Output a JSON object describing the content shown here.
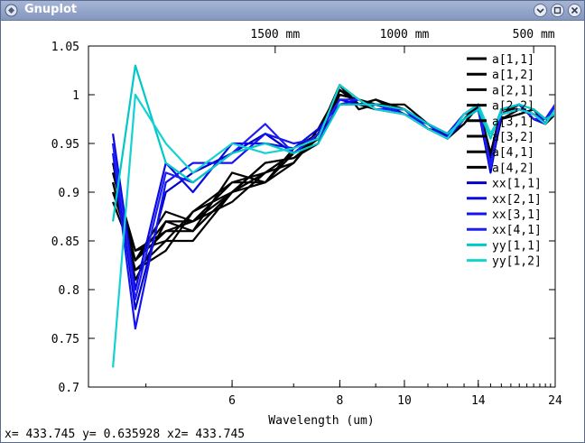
{
  "window": {
    "title": "Gnuplot",
    "buttons": [
      "chevron-down-icon",
      "restore-icon",
      "close-icon"
    ]
  },
  "status": {
    "text": "x= 433.745 y= 0.635928 x2= 433.745"
  },
  "chart_data": {
    "type": "line",
    "xlabel": "Wavelength (um)",
    "x_scale": "reciprocal",
    "xlim": [
      4.5,
      24
    ],
    "ylim": [
      0.7,
      1.05
    ],
    "x_ticks": [
      6,
      8,
      10,
      14,
      24
    ],
    "y_ticks": [
      0.7,
      0.75,
      0.8,
      0.85,
      0.9,
      0.95,
      1,
      1.05
    ],
    "y_tick_labels": [
      "0.7",
      "0.75",
      "0.8",
      "0.85",
      "0.9",
      "0.95",
      "1",
      "1.05"
    ],
    "x2_ticks": [
      {
        "x": 6.667,
        "label": "1500 mm"
      },
      {
        "x": 10,
        "label": "1000 mm"
      },
      {
        "x": 20,
        "label": "500 mm"
      }
    ],
    "grid": false,
    "legend_position": "top-right",
    "series": [
      {
        "name": "a[1,1]",
        "color": "#000000",
        "x": [
          4.7,
          4.9,
          5.2,
          5.5,
          6,
          6.5,
          7,
          7.5,
          8,
          8.5,
          9,
          10,
          11,
          12,
          13,
          14,
          15,
          16,
          18,
          20,
          22,
          24
        ],
        "y": [
          0.91,
          0.82,
          0.84,
          0.88,
          0.9,
          0.91,
          0.93,
          0.96,
          1.01,
          0.995,
          0.99,
          0.985,
          0.97,
          0.955,
          0.975,
          0.99,
          0.93,
          0.98,
          0.985,
          0.98,
          0.97,
          0.99
        ]
      },
      {
        "name": "a[1,2]",
        "color": "#000000",
        "x": [
          4.7,
          4.9,
          5.2,
          5.5,
          6,
          6.5,
          7,
          7.5,
          8,
          8.5,
          9,
          10,
          11,
          12,
          13,
          14,
          15,
          16,
          18,
          20,
          22,
          24
        ],
        "y": [
          0.92,
          0.83,
          0.86,
          0.87,
          0.91,
          0.92,
          0.94,
          0.955,
          1.005,
          0.99,
          0.995,
          0.98,
          0.965,
          0.96,
          0.98,
          0.985,
          0.925,
          0.975,
          0.98,
          0.985,
          0.975,
          0.985
        ]
      },
      {
        "name": "a[2,1]",
        "color": "#000000",
        "x": [
          4.7,
          4.9,
          5.2,
          5.5,
          6,
          6.5,
          7,
          7.5,
          8,
          8.5,
          9,
          10,
          11,
          12,
          13,
          14,
          15,
          16,
          18,
          20,
          22,
          24
        ],
        "y": [
          0.9,
          0.84,
          0.85,
          0.85,
          0.9,
          0.93,
          0.935,
          0.95,
          1.01,
          0.985,
          0.99,
          0.99,
          0.97,
          0.958,
          0.975,
          0.99,
          0.935,
          0.98,
          0.99,
          0.975,
          0.97,
          0.98
        ]
      },
      {
        "name": "a[2,2]",
        "color": "#000000",
        "x": [
          4.7,
          4.9,
          5.2,
          5.5,
          6,
          6.5,
          7,
          7.5,
          8,
          8.5,
          9,
          10,
          11,
          12,
          13,
          14,
          15,
          16,
          18,
          20,
          22,
          24
        ],
        "y": [
          0.93,
          0.81,
          0.87,
          0.86,
          0.92,
          0.91,
          0.94,
          0.96,
          1.0,
          0.995,
          0.99,
          0.985,
          0.965,
          0.955,
          0.97,
          0.988,
          0.94,
          0.985,
          0.985,
          0.98,
          0.975,
          0.99
        ]
      },
      {
        "name": "a[3,1]",
        "color": "#000000",
        "x": [
          4.7,
          4.9,
          5.2,
          5.5,
          6,
          6.5,
          7,
          7.5,
          8,
          8.5,
          9,
          10,
          11,
          12,
          13,
          14,
          15,
          16,
          18,
          20,
          22,
          24
        ],
        "y": [
          0.89,
          0.83,
          0.88,
          0.87,
          0.89,
          0.92,
          0.93,
          0.965,
          1.005,
          0.99,
          0.985,
          0.98,
          0.97,
          0.958,
          0.975,
          0.985,
          0.93,
          0.975,
          0.98,
          0.985,
          0.97,
          0.985
        ]
      },
      {
        "name": "a[3,2]",
        "color": "#000000",
        "x": [
          4.7,
          4.9,
          5.2,
          5.5,
          6,
          6.5,
          7,
          7.5,
          8,
          8.5,
          9,
          10,
          11,
          12,
          13,
          14,
          15,
          16,
          18,
          20,
          22,
          24
        ],
        "y": [
          0.91,
          0.82,
          0.85,
          0.88,
          0.91,
          0.91,
          0.945,
          0.96,
          1.01,
          0.99,
          0.995,
          0.985,
          0.965,
          0.96,
          0.98,
          0.99,
          0.935,
          0.98,
          0.985,
          0.98,
          0.975,
          0.99
        ]
      },
      {
        "name": "a[4,1]",
        "color": "#000000",
        "x": [
          4.7,
          4.9,
          5.2,
          5.5,
          6,
          6.5,
          7,
          7.5,
          8,
          8.5,
          9,
          10,
          11,
          12,
          13,
          14,
          15,
          16,
          18,
          20,
          22,
          24
        ],
        "y": [
          0.92,
          0.84,
          0.86,
          0.86,
          0.9,
          0.93,
          0.935,
          0.955,
          1.0,
          0.995,
          0.99,
          0.98,
          0.97,
          0.955,
          0.975,
          0.985,
          0.93,
          0.98,
          0.99,
          0.975,
          0.97,
          0.98
        ]
      },
      {
        "name": "a[4,2]",
        "color": "#000000",
        "x": [
          4.7,
          4.9,
          5.2,
          5.5,
          6,
          6.5,
          7,
          7.5,
          8,
          8.5,
          9,
          10,
          11,
          12,
          13,
          14,
          15,
          16,
          18,
          20,
          22,
          24
        ],
        "y": [
          0.9,
          0.83,
          0.87,
          0.87,
          0.9,
          0.92,
          0.94,
          0.96,
          1.005,
          0.99,
          0.99,
          0.985,
          0.965,
          0.958,
          0.97,
          0.99,
          0.94,
          0.975,
          0.985,
          0.98,
          0.975,
          0.985
        ]
      },
      {
        "name": "xx[1,1]",
        "color": "#0000c8",
        "x": [
          4.7,
          4.9,
          5.2,
          5.5,
          6,
          6.5,
          7,
          7.5,
          8,
          8.5,
          9,
          10,
          11,
          12,
          13,
          14,
          15,
          16,
          18,
          20,
          22,
          24
        ],
        "y": [
          0.95,
          0.78,
          0.9,
          0.92,
          0.94,
          0.96,
          0.94,
          0.96,
          0.995,
          0.99,
          0.99,
          0.98,
          0.97,
          0.96,
          0.975,
          0.985,
          0.92,
          0.98,
          0.985,
          0.98,
          0.975,
          0.985
        ]
      },
      {
        "name": "xx[2,1]",
        "color": "#0a0ae0",
        "x": [
          4.7,
          4.9,
          5.2,
          5.5,
          6,
          6.5,
          7,
          7.5,
          8,
          8.5,
          9,
          10,
          11,
          12,
          13,
          14,
          15,
          16,
          18,
          20,
          22,
          24
        ],
        "y": [
          0.96,
          0.8,
          0.93,
          0.9,
          0.95,
          0.95,
          0.945,
          0.965,
          0.99,
          0.995,
          0.985,
          0.985,
          0.965,
          0.958,
          0.98,
          0.99,
          0.925,
          0.985,
          0.99,
          0.975,
          0.97,
          0.99
        ]
      },
      {
        "name": "xx[3,1]",
        "color": "#1414f0",
        "x": [
          4.7,
          4.9,
          5.2,
          5.5,
          6,
          6.5,
          7,
          7.5,
          8,
          8.5,
          9,
          10,
          11,
          12,
          13,
          14,
          15,
          16,
          18,
          20,
          22,
          24
        ],
        "y": [
          0.94,
          0.76,
          0.91,
          0.93,
          0.93,
          0.96,
          0.95,
          0.955,
          0.99,
          0.99,
          0.99,
          0.98,
          0.97,
          0.955,
          0.975,
          0.985,
          0.93,
          0.98,
          0.985,
          0.98,
          0.975,
          0.985
        ]
      },
      {
        "name": "xx[4,1]",
        "color": "#1e1ef5",
        "x": [
          4.7,
          4.9,
          5.2,
          5.5,
          6,
          6.5,
          7,
          7.5,
          8,
          8.5,
          9,
          10,
          11,
          12,
          13,
          14,
          15,
          16,
          18,
          20,
          22,
          24
        ],
        "y": [
          0.95,
          0.79,
          0.92,
          0.91,
          0.94,
          0.97,
          0.94,
          0.96,
          0.995,
          0.995,
          0.985,
          0.985,
          0.97,
          0.96,
          0.98,
          0.99,
          0.925,
          0.985,
          0.99,
          0.975,
          0.975,
          0.99
        ]
      },
      {
        "name": "yy[1,1]",
        "color": "#00c8c8",
        "x": [
          4.7,
          4.9,
          5.2,
          5.5,
          6,
          6.5,
          7,
          7.5,
          8,
          8.5,
          9,
          10,
          11,
          12,
          13,
          14,
          15,
          16,
          18,
          20,
          22,
          24
        ],
        "y": [
          0.87,
          1.03,
          0.93,
          0.91,
          0.94,
          0.95,
          0.94,
          0.95,
          0.99,
          0.99,
          0.99,
          0.985,
          0.97,
          0.96,
          0.975,
          0.985,
          0.955,
          0.985,
          0.99,
          0.985,
          0.975,
          0.98
        ]
      },
      {
        "name": "yy[1,2]",
        "color": "#14d2d2",
        "x": [
          4.7,
          4.9,
          5.2,
          5.5,
          6,
          6.5,
          7,
          7.5,
          8,
          8.5,
          9,
          10,
          11,
          12,
          13,
          14,
          15,
          16,
          18,
          20,
          22,
          24
        ],
        "y": [
          0.72,
          1.0,
          0.95,
          0.92,
          0.95,
          0.94,
          0.945,
          0.955,
          1.01,
          0.995,
          0.985,
          0.98,
          0.965,
          0.955,
          0.98,
          0.99,
          0.96,
          0.98,
          0.985,
          0.98,
          0.97,
          0.985
        ]
      }
    ]
  }
}
